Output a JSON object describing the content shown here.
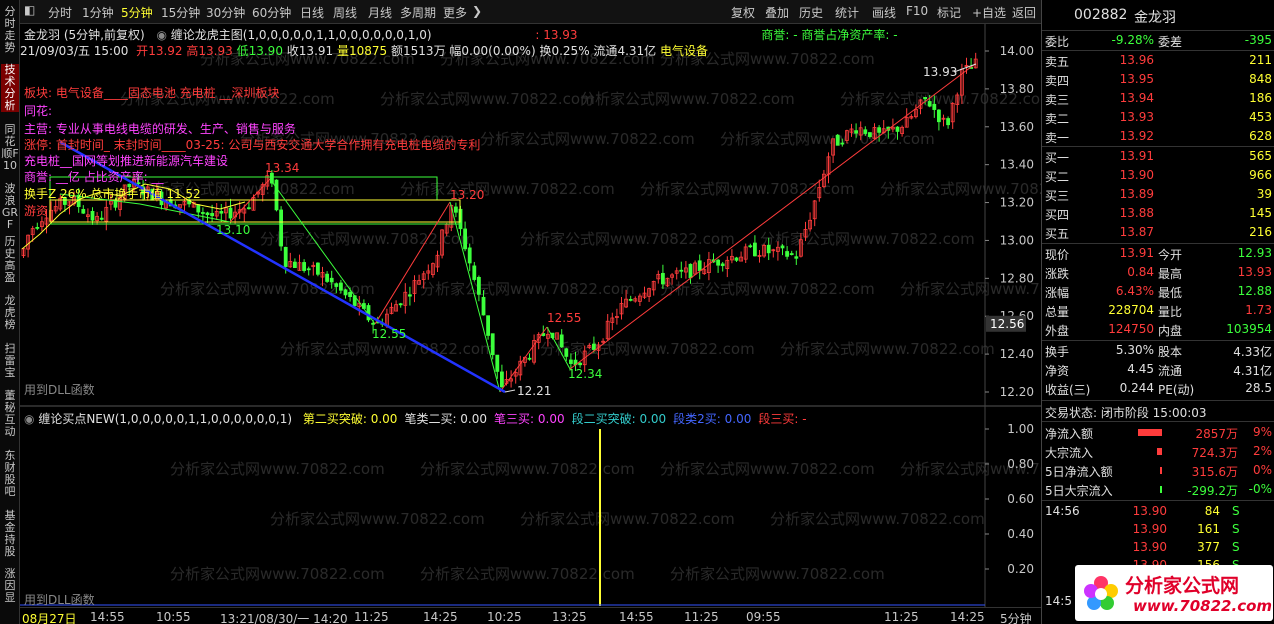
{
  "left_tabs": [
    "分时走势",
    "技术分析",
    "同花顺F10",
    "波浪GRF",
    "历史高盈",
    "龙虎榜",
    "扫雷宝",
    "董秘互动",
    "东财股吧",
    "基金持股",
    "涨因显"
  ],
  "toolbar": {
    "left": [
      "分时",
      "1分钟",
      "5分钟",
      "15分钟",
      "30分钟",
      "60分钟",
      "日线",
      "周线",
      "月线",
      "多周期",
      "更多"
    ],
    "right": [
      "复权",
      "叠加",
      "历史",
      "统计",
      "画线",
      "F10",
      "标记",
      "+自选",
      "返回"
    ]
  },
  "header": {
    "title": "金龙羽 (5分钟,前复权)",
    "indicator_name": "缠论龙虎主图(1,0,0,0,0,0,1,1,0,0,0,0,0,0,1,0)",
    "indicator_value": ": 13.93",
    "shangyu": "商誉: - 商誉占净资产率: -",
    "bar_date": "21/09/03/五 15:00",
    "open_label": "开",
    "open": "13.92",
    "high_label": "高",
    "high": "13.93",
    "low_label": "低",
    "low": "13.90",
    "close_label": "收",
    "close": "13.91",
    "vol_label": "量",
    "vol": "10875",
    "amt_label": "额",
    "amt": "1513万",
    "chg_label": "幅",
    "chg": "0.00(0.00%)",
    "turn_label": "换",
    "turn": "0.25%",
    "float_label": "流通",
    "float": "4.31亿",
    "sector": "电气设备"
  },
  "annotations": [
    {
      "text": "板块: 电气设备____固态电池 充电桩 __深圳板块",
      "color": "#ff3c3c"
    },
    {
      "text": "同花:",
      "color": "#ff44ff"
    },
    {
      "text": "主营: 专业从事电线电缆的研发、生产、销售与服务",
      "color": "#ff44ff"
    },
    {
      "text": "涨停: 首封时间_ 末封时间____03-25: 公司与西安交通大学合作拥有充电桩电缆的专利",
      "color": "#ff3c3c"
    },
    {
      "text": "充电桩__国网等划推进新能源汽车建设",
      "color": "#ff44ff"
    },
    {
      "text": "商誉: __亿 占比资产率: __",
      "color": "#ff44ff"
    },
    {
      "text": "换手Z 26% 总市换手市值 11.52",
      "color": "#ffff33"
    },
    {
      "text": "游资",
      "color": "#ff3c3c"
    }
  ],
  "price_axis": [
    "14.00",
    "13.80",
    "13.60",
    "13.40",
    "13.20",
    "13.00",
    "12.80",
    "12.60",
    "12.40",
    "12.20"
  ],
  "current_price_tag": "12.56",
  "dll_label": "用到DLL函数",
  "chart_labels": [
    {
      "text": "13.93",
      "color": "#e0e0e0"
    },
    {
      "text": "13.34",
      "color": "#ff3c3c"
    },
    {
      "text": "13.20",
      "color": "#ff3c3c"
    },
    {
      "text": "13.10",
      "color": "#3cff3c"
    },
    {
      "text": "12.55",
      "color": "#3cff3c"
    },
    {
      "text": "12.55",
      "color": "#ff3c3c"
    },
    {
      "text": "12.34",
      "color": "#3cff3c"
    },
    {
      "text": "12.21",
      "color": "#e0e0e0"
    }
  ],
  "sub_indicator": {
    "name": "缠论买点NEW(1,0,0,0,0,0,1,1,0,0,0,0,0,0,1)",
    "items": [
      {
        "label": "第二买突破: 0.00",
        "color": "#ffff33"
      },
      {
        "label": "笔类二买: 0.00",
        "color": "#e0e0e0"
      },
      {
        "label": "笔三买: 0.00",
        "color": "#ff44ff"
      },
      {
        "label": "段二买突破: 0.00",
        "color": "#33cccc"
      },
      {
        "label": "段类2买: 0.00",
        "color": "#4466ff"
      },
      {
        "label": "段三买: -",
        "color": "#ff3c3c"
      }
    ],
    "axis": [
      "1.00",
      "0.80",
      "0.60",
      "0.40",
      "0.20"
    ]
  },
  "watermark": "分析家公式网www.70822.com",
  "time_axis": [
    "08月27日",
    "14:55",
    "10:55",
    "13:21/08/30/一 14:20",
    "11:25",
    "14:25",
    "10:25",
    "13:25",
    "14:55",
    "11:25",
    "09:55",
    "11:25",
    "14:25"
  ],
  "period_label": "5分钟",
  "right_panel": {
    "code": "002882",
    "name": "金龙羽",
    "weibi_label": "委比",
    "weibi": "-9.28%",
    "weicha_label": "委差",
    "weicha": "-395",
    "asks": [
      {
        "label": "卖五",
        "price": "13.96",
        "vol": "211"
      },
      {
        "label": "卖四",
        "price": "13.95",
        "vol": "848"
      },
      {
        "label": "卖三",
        "price": "13.94",
        "vol": "186"
      },
      {
        "label": "卖二",
        "price": "13.93",
        "vol": "453"
      },
      {
        "label": "卖一",
        "price": "13.92",
        "vol": "628"
      }
    ],
    "bids": [
      {
        "label": "买一",
        "price": "13.91",
        "vol": "565"
      },
      {
        "label": "买二",
        "price": "13.90",
        "vol": "966"
      },
      {
        "label": "买三",
        "price": "13.89",
        "vol": "39"
      },
      {
        "label": "买四",
        "price": "13.88",
        "vol": "145"
      },
      {
        "label": "买五",
        "price": "13.87",
        "vol": "216"
      }
    ],
    "quote": [
      {
        "l1": "现价",
        "v1": "13.91",
        "c1": "#ff3c3c",
        "l2": "今开",
        "v2": "12.93",
        "c2": "#3cff3c"
      },
      {
        "l1": "涨跌",
        "v1": "0.84",
        "c1": "#ff3c3c",
        "l2": "最高",
        "v2": "13.93",
        "c2": "#ff3c3c"
      },
      {
        "l1": "涨幅",
        "v1": "6.43%",
        "c1": "#ff3c3c",
        "l2": "最低",
        "v2": "12.88",
        "c2": "#3cff3c"
      },
      {
        "l1": "总量",
        "v1": "228704",
        "c1": "#ffff33",
        "l2": "量比",
        "v2": "1.73",
        "c2": "#ff3c3c"
      },
      {
        "l1": "外盘",
        "v1": "124750",
        "c1": "#ff3c3c",
        "l2": "内盘",
        "v2": "103954",
        "c2": "#3cff3c"
      }
    ],
    "quote2": [
      {
        "l1": "换手",
        "v1": "5.30%",
        "l2": "股本",
        "v2": "4.33亿"
      },
      {
        "l1": "净资",
        "v1": "4.45",
        "l2": "流通",
        "v2": "4.31亿"
      },
      {
        "l1": "收益(三)",
        "v1": "0.244",
        "l2": "PE(动)",
        "v2": "28.5"
      }
    ],
    "status": "交易状态: 闭市阶段 15:00:03",
    "flows": [
      {
        "label": "净流入额",
        "value": "2857万",
        "pct": "9%",
        "color": "#ff3c3c",
        "bar": 0.9
      },
      {
        "label": "大宗流入",
        "value": "724.3万",
        "pct": "2%",
        "color": "#ff3c3c",
        "bar": 0.2
      },
      {
        "label": "5日净流入额",
        "value": "315.6万",
        "pct": "0%",
        "color": "#ff3c3c",
        "bar": 0.05
      },
      {
        "label": "5日大宗流入",
        "value": "-299.2万",
        "pct": "-0%",
        "color": "#3cff3c",
        "bar": 0.05
      }
    ],
    "ticks": [
      {
        "time": "14:56",
        "price": "13.90",
        "vol": "84",
        "side": "S"
      },
      {
        "time": "",
        "price": "13.90",
        "vol": "161",
        "side": "S"
      },
      {
        "time": "",
        "price": "13.90",
        "vol": "377",
        "side": "S"
      },
      {
        "time": "",
        "price": "13.90",
        "vol": "156",
        "side": "S"
      }
    ],
    "last_tick_time": "14:5"
  },
  "logo": {
    "text": "分析家公式网",
    "url": "www.70822.com"
  },
  "colors": {
    "up": "#ff3c3c",
    "down": "#3cff3c",
    "ma": "#ffff33"
  }
}
